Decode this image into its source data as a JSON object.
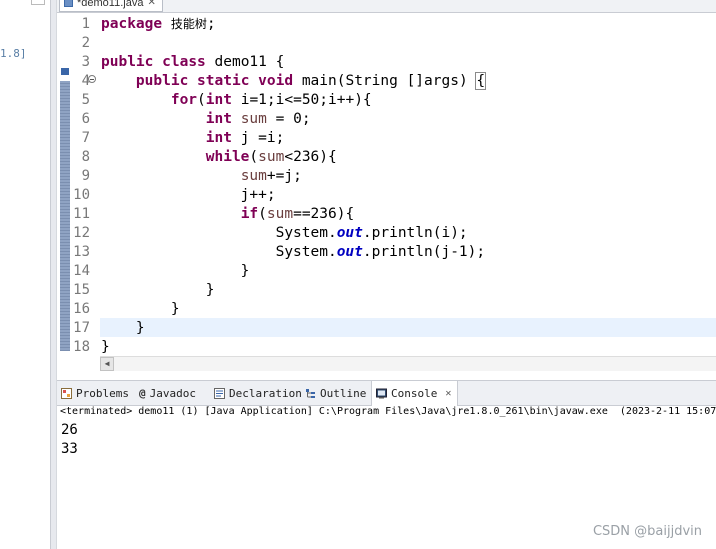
{
  "left_pane": {
    "fragment": "1.8]"
  },
  "editor": {
    "tab_label": "*demo11.java",
    "icons": {
      "file": "java-file-icon",
      "close": "close-icon"
    },
    "lines": [
      {
        "n": "1",
        "segs": [
          {
            "t": "package",
            "c": "kw"
          },
          {
            "t": " "
          },
          {
            "t": "技能树",
            "c": "cjk"
          },
          {
            "t": ";"
          }
        ]
      },
      {
        "n": "2",
        "segs": []
      },
      {
        "n": "3",
        "segs": [
          {
            "t": "public",
            "c": "kw"
          },
          {
            "t": " "
          },
          {
            "t": "class",
            "c": "kw"
          },
          {
            "t": " demo11 {"
          }
        ]
      },
      {
        "n": "4",
        "segs": [
          {
            "t": "    "
          },
          {
            "t": "public",
            "c": "kw"
          },
          {
            "t": " "
          },
          {
            "t": "static",
            "c": "kw"
          },
          {
            "t": " "
          },
          {
            "t": "void",
            "c": "kw"
          },
          {
            "t": " main(String []args) "
          },
          {
            "t": "{",
            "c": "brace-box"
          }
        ]
      },
      {
        "n": "5",
        "segs": [
          {
            "t": "        "
          },
          {
            "t": "for",
            "c": "kw"
          },
          {
            "t": "("
          },
          {
            "t": "int",
            "c": "kw"
          },
          {
            "t": " i=1;i<=50;i++){"
          }
        ]
      },
      {
        "n": "6",
        "segs": [
          {
            "t": "            "
          },
          {
            "t": "int",
            "c": "kw"
          },
          {
            "t": " "
          },
          {
            "t": "sum",
            "c": "var"
          },
          {
            "t": " = 0;"
          }
        ]
      },
      {
        "n": "7",
        "segs": [
          {
            "t": "            "
          },
          {
            "t": "int",
            "c": "kw"
          },
          {
            "t": " j =i;"
          }
        ]
      },
      {
        "n": "8",
        "segs": [
          {
            "t": "            "
          },
          {
            "t": "while",
            "c": "kw"
          },
          {
            "t": "("
          },
          {
            "t": "sum",
            "c": "var"
          },
          {
            "t": "<236){"
          }
        ]
      },
      {
        "n": "9",
        "segs": [
          {
            "t": "                "
          },
          {
            "t": "sum",
            "c": "var"
          },
          {
            "t": "+=j;"
          }
        ]
      },
      {
        "n": "10",
        "segs": [
          {
            "t": "                j++;"
          }
        ]
      },
      {
        "n": "11",
        "segs": [
          {
            "t": "                "
          },
          {
            "t": "if",
            "c": "kw"
          },
          {
            "t": "("
          },
          {
            "t": "sum",
            "c": "var"
          },
          {
            "t": "==236){"
          }
        ]
      },
      {
        "n": "12",
        "segs": [
          {
            "t": "                    System."
          },
          {
            "t": "out",
            "c": "fld"
          },
          {
            "t": ".println(i);"
          }
        ]
      },
      {
        "n": "13",
        "segs": [
          {
            "t": "                    System."
          },
          {
            "t": "out",
            "c": "fld"
          },
          {
            "t": ".println(j-1);"
          }
        ]
      },
      {
        "n": "14",
        "segs": [
          {
            "t": "                }"
          }
        ]
      },
      {
        "n": "15",
        "segs": [
          {
            "t": "            }"
          }
        ]
      },
      {
        "n": "16",
        "segs": [
          {
            "t": "        }"
          }
        ]
      },
      {
        "n": "17",
        "segs": [
          {
            "t": "    }"
          }
        ]
      },
      {
        "n": "18",
        "segs": [
          {
            "t": "}"
          }
        ]
      }
    ],
    "current_line": "17"
  },
  "views": {
    "tabs": [
      {
        "id": "problems",
        "label": "Problems",
        "icon": "problems-icon"
      },
      {
        "id": "javadoc",
        "label": "Javadoc",
        "icon": "at-icon"
      },
      {
        "id": "declaration",
        "label": "Declaration",
        "icon": "declaration-icon"
      },
      {
        "id": "outline",
        "label": "Outline",
        "icon": "outline-icon"
      },
      {
        "id": "console",
        "label": "Console",
        "icon": "console-icon",
        "active": true
      }
    ]
  },
  "console": {
    "status": "<terminated> demo11 (1) [Java Application] C:\\Program Files\\Java\\jre1.8.0_261\\bin\\javaw.exe  (2023-2-11 15:07:",
    "output": [
      "26",
      "33"
    ]
  },
  "watermark": "CSDN @baijjdvin"
}
